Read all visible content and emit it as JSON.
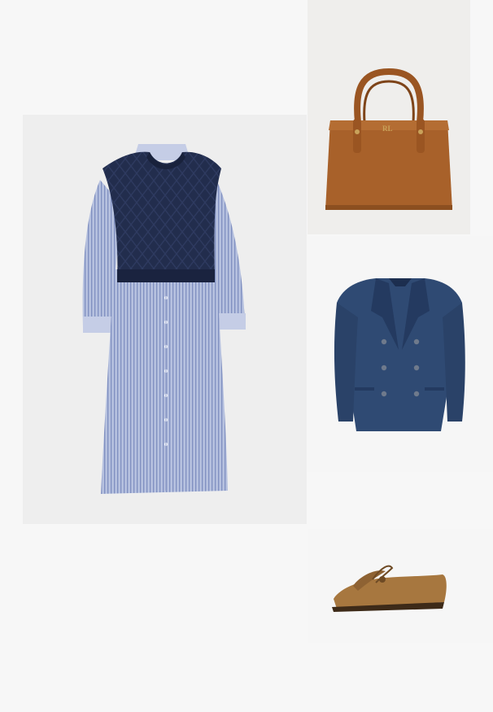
{
  "collage": {
    "products": [
      {
        "id": "dress",
        "kind": "cable-knit vest over striped shirt dress",
        "vest_color": "#1f2a4a",
        "dress_color": "#a9b6d8"
      },
      {
        "id": "bag",
        "kind": "leather tote bag",
        "color": "#a8612a",
        "hardware": "#c9a25a"
      },
      {
        "id": "jacket",
        "kind": "double-breasted blazer",
        "color": "#2f4a73"
      },
      {
        "id": "loafer",
        "kind": "suede tassel loafer",
        "color": "#a7773f"
      }
    ],
    "bag_logo": "RL"
  }
}
